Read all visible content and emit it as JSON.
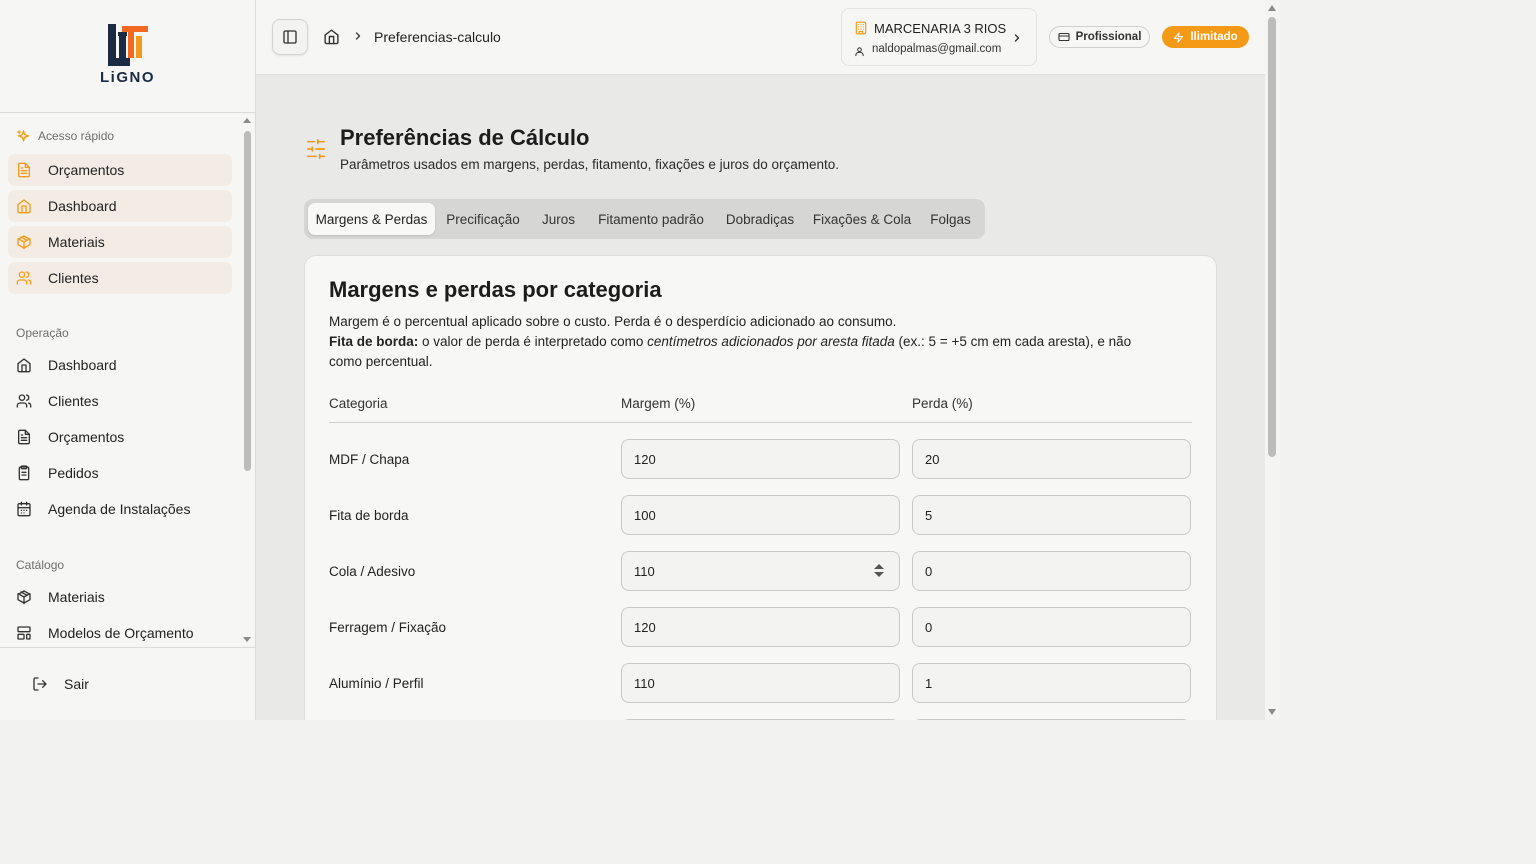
{
  "brand": {
    "name": "LiGNO",
    "accent": "#f59a16",
    "dark": "#1b2b44"
  },
  "sidebar": {
    "quick_access_label": "Acesso rápido",
    "quick_items": [
      {
        "label": "Orçamentos",
        "icon": "file-text-icon"
      },
      {
        "label": "Dashboard",
        "icon": "home-icon"
      },
      {
        "label": "Materiais",
        "icon": "package-icon"
      },
      {
        "label": "Clientes",
        "icon": "users-icon"
      }
    ],
    "operation_label": "Operação",
    "operation_items": [
      {
        "label": "Dashboard",
        "icon": "home-icon"
      },
      {
        "label": "Clientes",
        "icon": "users-icon"
      },
      {
        "label": "Orçamentos",
        "icon": "file-text-icon"
      },
      {
        "label": "Pedidos",
        "icon": "clipboard-icon"
      },
      {
        "label": "Agenda de Instalações",
        "icon": "calendar-icon"
      }
    ],
    "catalog_label": "Catálogo",
    "catalog_items": [
      {
        "label": "Materiais",
        "icon": "package-icon"
      },
      {
        "label": "Modelos de Orçamento",
        "icon": "layout-template-icon"
      }
    ],
    "logout_label": "Sair"
  },
  "header": {
    "breadcrumb_current": "Preferencias-calculo",
    "company_name": "MARCENARIA 3 RIOS",
    "company_email": "naldopalmas@gmail.com",
    "plan_label": "Profissional",
    "unlimited_label": "Ilimitado"
  },
  "page": {
    "title": "Preferências de Cálculo",
    "subtitle": "Parâmetros usados em margens, perdas, fitamento, fixações e juros do orçamento."
  },
  "tabs": [
    {
      "label": "Margens & Perdas",
      "active": true
    },
    {
      "label": "Precificação",
      "active": false
    },
    {
      "label": "Juros",
      "active": false
    },
    {
      "label": "Fitamento padrão",
      "active": false
    },
    {
      "label": "Dobradiças",
      "active": false
    },
    {
      "label": "Fixações & Cola",
      "active": false
    },
    {
      "label": "Folgas",
      "active": false
    }
  ],
  "card": {
    "title": "Margens e perdas por categoria",
    "desc_line1": "Margem é o percentual aplicado sobre o custo. Perda é o desperdício adicionado ao consumo.",
    "desc_bold": "Fita de borda:",
    "desc_part1": " o valor de perda é interpretado como ",
    "desc_italic": "centímetros adicionados por aresta fitada",
    "desc_part2": " (ex.: 5 = +5 cm em cada aresta), e não como percentual.",
    "columns": {
      "category": "Categoria",
      "margin": "Margem (%)",
      "loss": "Perda (%)"
    },
    "rows": [
      {
        "category": "MDF / Chapa",
        "margin": "120",
        "loss": "20"
      },
      {
        "category": "Fita de borda",
        "margin": "100",
        "loss": "5"
      },
      {
        "category": "Cola / Adesivo",
        "margin": "110",
        "loss": "0"
      },
      {
        "category": "Ferragem / Fixação",
        "margin": "120",
        "loss": "0"
      },
      {
        "category": "Alumínio / Perfil",
        "margin": "110",
        "loss": "1"
      }
    ]
  }
}
